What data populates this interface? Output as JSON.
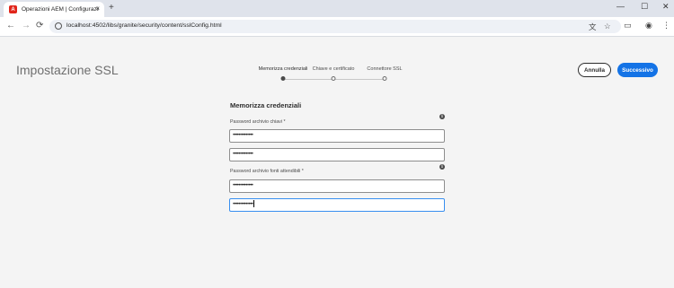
{
  "browser": {
    "tab_title": "Operazioni AEM | Configurazio",
    "tab_close": "×",
    "new_tab": "+",
    "url": "localhost:4502/libs/granite/security/content/sslConfig.html",
    "nav": {
      "back": "←",
      "forward": "→",
      "reload": "⟳"
    },
    "window_controls": {
      "minimize": "—",
      "maximize": "☐",
      "close": "✕"
    },
    "icons": {
      "translate": "translate-icon",
      "bookmark": "star-icon",
      "side_panel": "side-panel-icon",
      "profile": "profile-icon",
      "menu": "more-vert-icon"
    }
  },
  "header": {
    "title": "Impostazione SSL",
    "steps": [
      {
        "label": "Memorizza credenziali",
        "active": true
      },
      {
        "label": "Chiave e certificato",
        "active": false
      },
      {
        "label": "Connettore SSL",
        "active": false
      }
    ],
    "cancel_label": "Annulla",
    "next_label": "Successivo"
  },
  "form": {
    "title": "Memorizza credenziali",
    "keystore": {
      "label": "Password archivio chiavi *",
      "password": "••••••••••••••",
      "confirm": "••••••••••••••"
    },
    "truststore": {
      "label": "Password archivio fonti attendibili *",
      "password": "••••••••••••••",
      "confirm": "••••••••••••••"
    },
    "info_glyph": "i"
  },
  "colors": {
    "accent": "#1473e6",
    "background": "#f4f4f4",
    "focus": "#378ef0"
  }
}
